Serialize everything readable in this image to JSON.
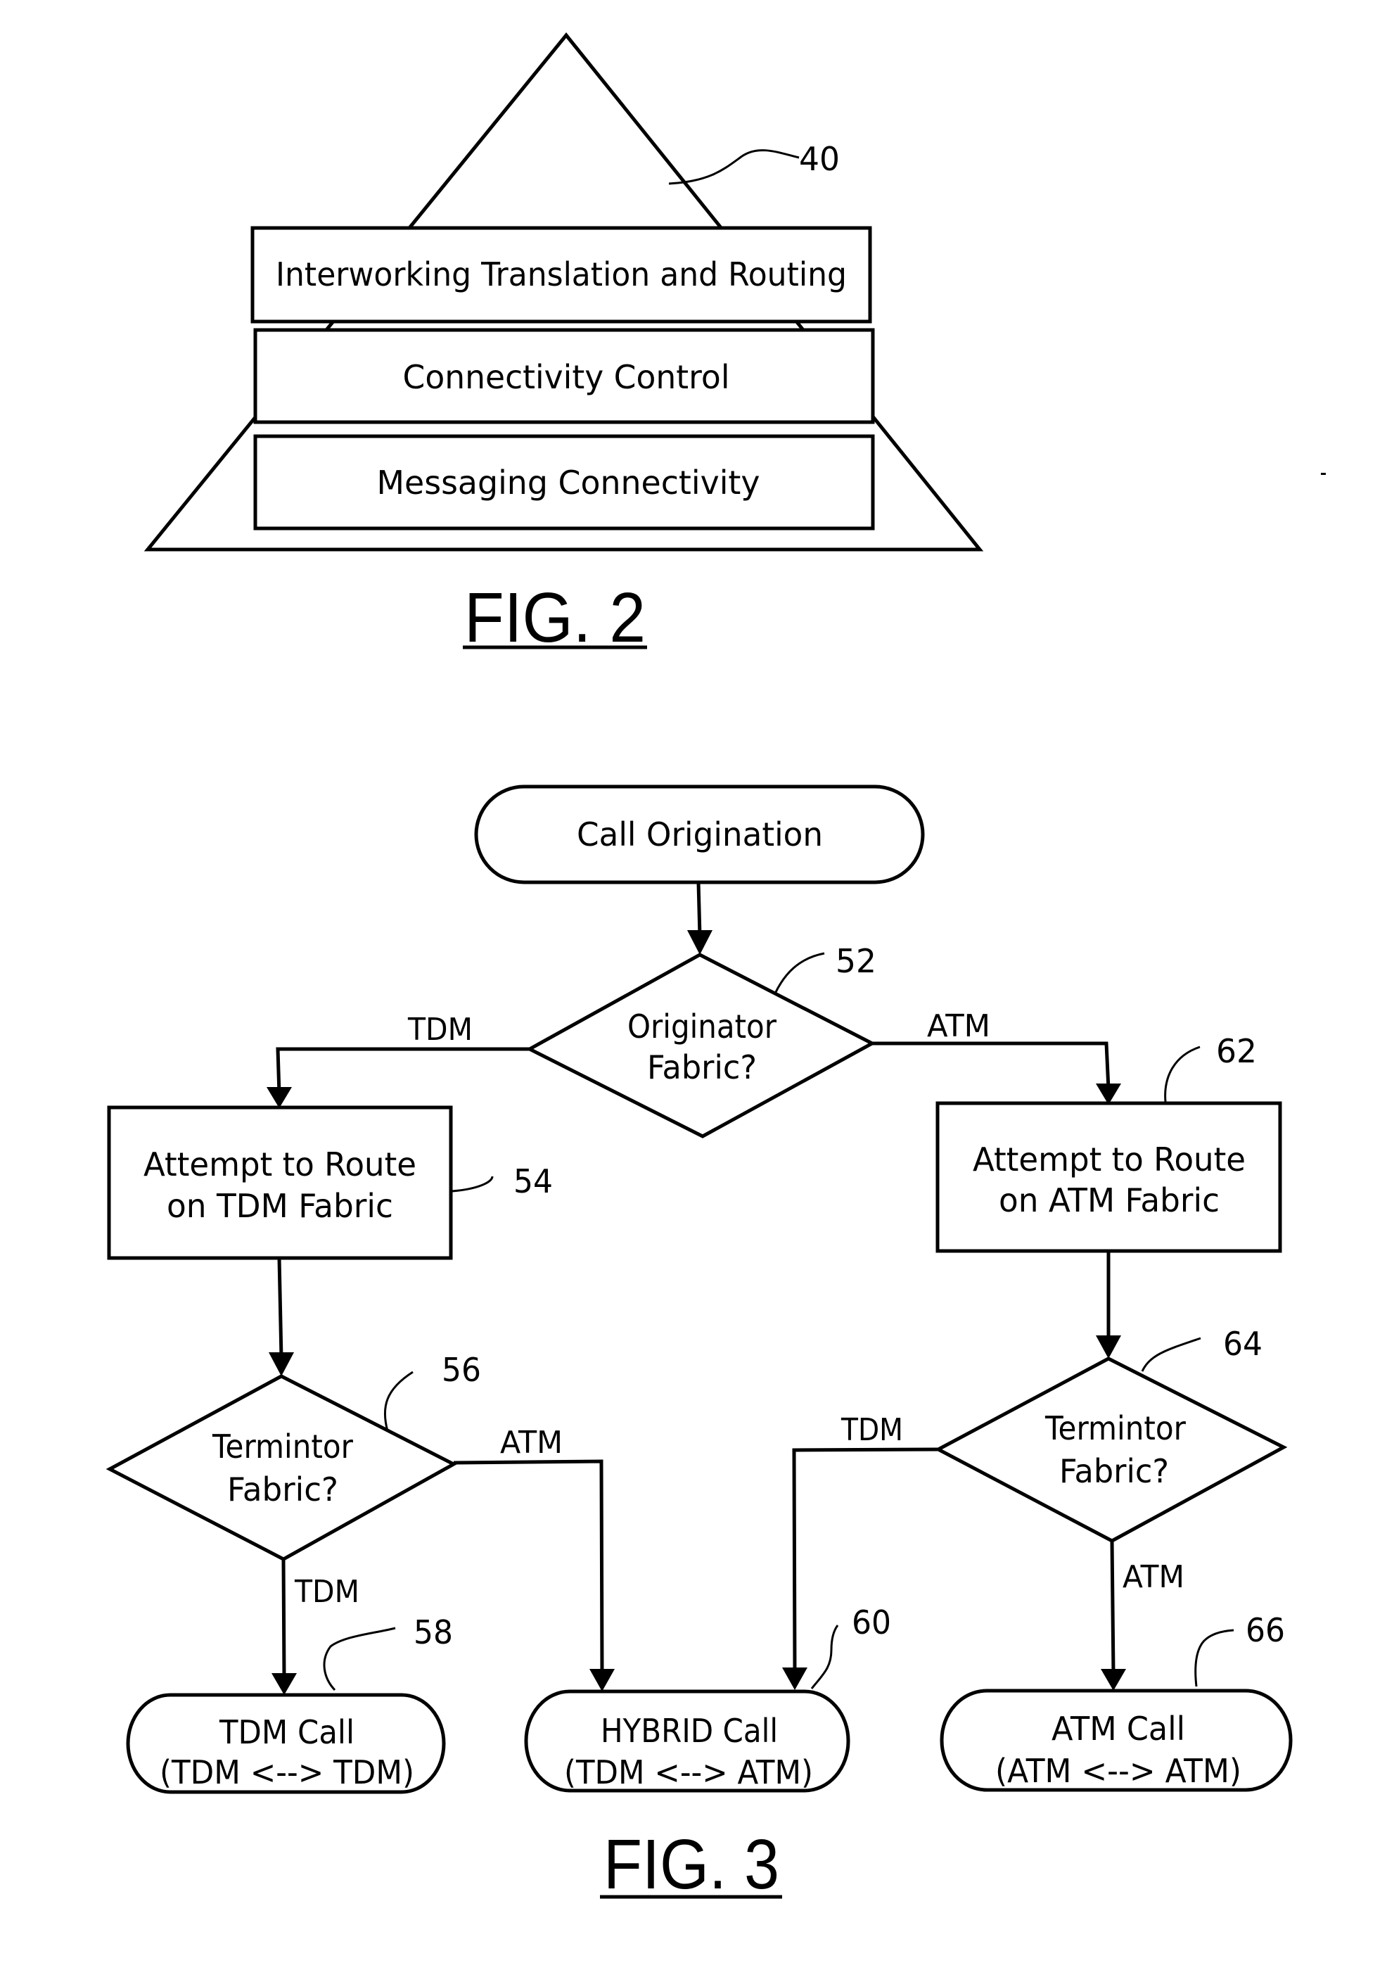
{
  "figures": {
    "fig2": {
      "caption": "FIG. 2",
      "reference": "40",
      "layers": [
        {
          "label": "Interworking Translation and Routing"
        },
        {
          "label": "Connectivity Control"
        },
        {
          "label": "Messaging Connectivity"
        }
      ]
    },
    "fig3": {
      "caption": "FIG. 3",
      "start": {
        "label": "Call Origination"
      },
      "originator_decision": {
        "lines": [
          "Originator",
          "Fabric?"
        ],
        "reference": "52",
        "left_branch": "TDM",
        "right_branch": "ATM"
      },
      "route_tdm": {
        "lines": [
          "Attempt to Route",
          "on TDM Fabric"
        ],
        "reference": "54"
      },
      "route_atm": {
        "lines": [
          "Attempt to Route",
          "on ATM Fabric"
        ],
        "reference": "62"
      },
      "terminator_decision_tdm": {
        "lines": [
          "Termintor",
          "Fabric?"
        ],
        "reference": "56",
        "right_branch": "ATM",
        "down_branch": "TDM"
      },
      "terminator_decision_atm": {
        "lines": [
          "Termintor",
          "Fabric?"
        ],
        "reference": "64",
        "left_branch": "TDM",
        "down_branch": "ATM"
      },
      "tdm_call": {
        "lines": [
          "TDM Call",
          "(TDM <--> TDM)"
        ],
        "reference": "58"
      },
      "hybrid_call": {
        "lines": [
          "HYBRID Call",
          "(TDM <--> ATM)"
        ],
        "reference": "60"
      },
      "atm_call": {
        "lines": [
          "ATM Call",
          "(ATM <--> ATM)"
        ],
        "reference": "66"
      }
    }
  }
}
